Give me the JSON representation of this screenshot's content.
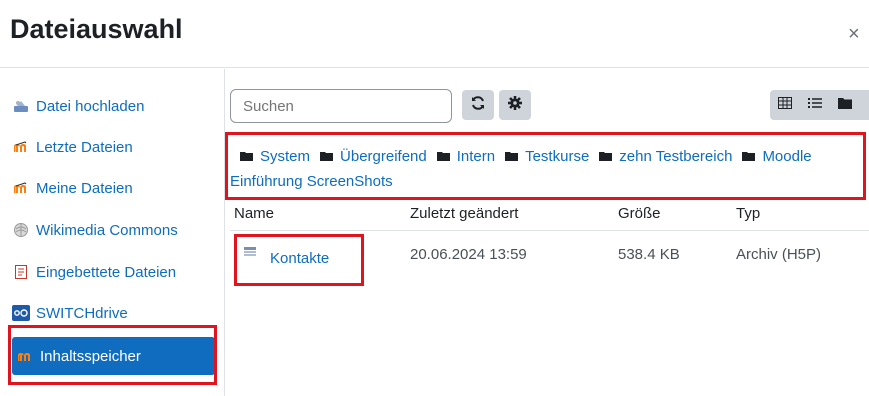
{
  "dialog": {
    "title": "Dateiauswahl",
    "close_symbol": "×"
  },
  "sidebar": {
    "items": [
      {
        "label": "Datei hochladen",
        "icon": "upload-icon"
      },
      {
        "label": "Letzte Dateien",
        "icon": "moodle-repo-icon"
      },
      {
        "label": "Meine Dateien",
        "icon": "moodle-repo-icon"
      },
      {
        "label": "Wikimedia Commons",
        "icon": "wikimedia-icon"
      },
      {
        "label": "Eingebettete Dateien",
        "icon": "embedded-files-icon"
      },
      {
        "label": "SWITCHdrive",
        "icon": "switchdrive-icon"
      },
      {
        "label": "Inhaltsspeicher",
        "icon": "moodle-repo-icon",
        "active": true
      }
    ]
  },
  "toolbar": {
    "search_placeholder": "Suchen",
    "refresh_icon": "refresh-icon",
    "settings_icon": "gear-icon",
    "view_icons": [
      "grid-view-icon",
      "list-view-icon",
      "folder-view-icon"
    ]
  },
  "breadcrumb": {
    "items": [
      "System",
      "Übergreifend",
      "Intern",
      "Testkurse",
      "zehn Testbereich",
      "Moodle"
    ],
    "continuation": "Einführung ScreenShots"
  },
  "table": {
    "headers": [
      "Name",
      "Zuletzt geändert",
      "Größe",
      "Typ"
    ],
    "rows": [
      {
        "name": "Kontakte",
        "modified": "20.06.2024 13:59",
        "size": "538.4 KB",
        "type": "Archiv (H5P)"
      }
    ]
  },
  "colors": {
    "accent": "#0f6cbf",
    "highlight_outline": "#e0141e",
    "button_bg": "#ced4da"
  }
}
